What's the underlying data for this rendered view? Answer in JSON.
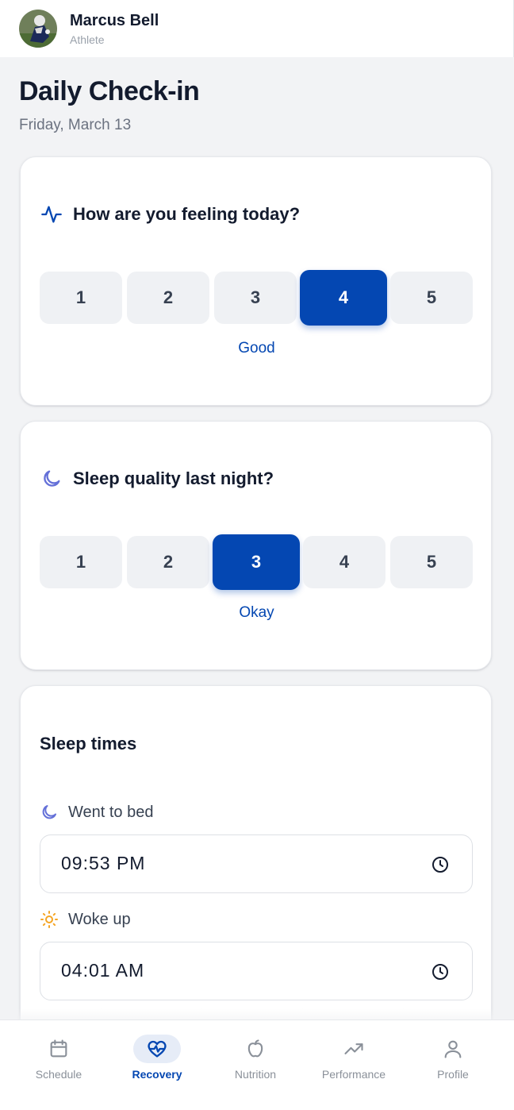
{
  "header": {
    "user_name": "Marcus Bell",
    "user_role": "Athlete"
  },
  "page": {
    "title": "Daily Check-in",
    "date": "Friday, March 13"
  },
  "feeling": {
    "icon": "activity-pulse-icon",
    "question": "How are you feeling today?",
    "options": [
      "1",
      "2",
      "3",
      "4",
      "5"
    ],
    "selected": "4",
    "selected_label": "Good"
  },
  "sleep_quality": {
    "icon": "moon-icon",
    "question": "Sleep quality last night?",
    "options": [
      "1",
      "2",
      "3",
      "4",
      "5"
    ],
    "selected": "3",
    "selected_label": "Okay"
  },
  "sleep_times": {
    "title": "Sleep times",
    "bed": {
      "icon": "moon-icon",
      "label": "Went to bed",
      "value": "09:53 PM"
    },
    "wake": {
      "icon": "sun-icon",
      "label": "Woke up",
      "value": "04:01 AM"
    }
  },
  "nav": {
    "items": [
      {
        "label": "Schedule",
        "icon": "calendar-icon"
      },
      {
        "label": "Recovery",
        "icon": "heart-pulse-icon"
      },
      {
        "label": "Nutrition",
        "icon": "apple-icon"
      },
      {
        "label": "Performance",
        "icon": "trending-up-icon"
      },
      {
        "label": "Profile",
        "icon": "user-icon"
      }
    ],
    "active": "Recovery"
  },
  "colors": {
    "accent": "#0447b2",
    "moon": "#6470d8",
    "sun": "#f5a524",
    "background": "#f2f3f5"
  }
}
